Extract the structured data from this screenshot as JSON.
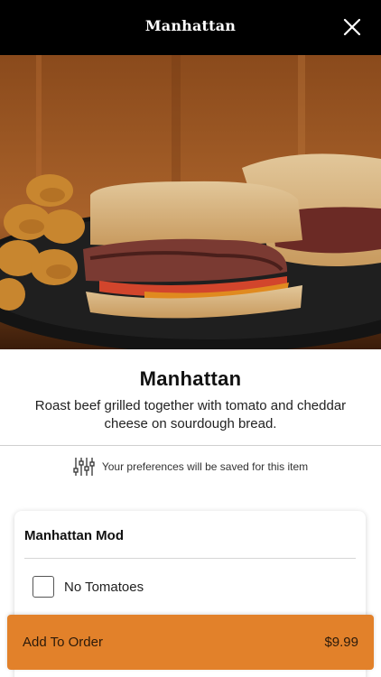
{
  "header": {
    "title": "Manhattan",
    "close_icon": "close-icon"
  },
  "item": {
    "name": "Manhattan",
    "description": "Roast beef grilled together with tomato and cheddar cheese on sourdough bread."
  },
  "preferences": {
    "icon": "sliders-icon",
    "text": "Your preferences will be saved for this item"
  },
  "modifier_group": {
    "title": "Manhattan Mod",
    "options": [
      {
        "label": "No Tomatoes",
        "checked": false
      }
    ]
  },
  "order_button": {
    "label": "Add To Order",
    "price": "$9.99"
  },
  "colors": {
    "header_bg": "#000000",
    "accent": "#e2812a"
  }
}
